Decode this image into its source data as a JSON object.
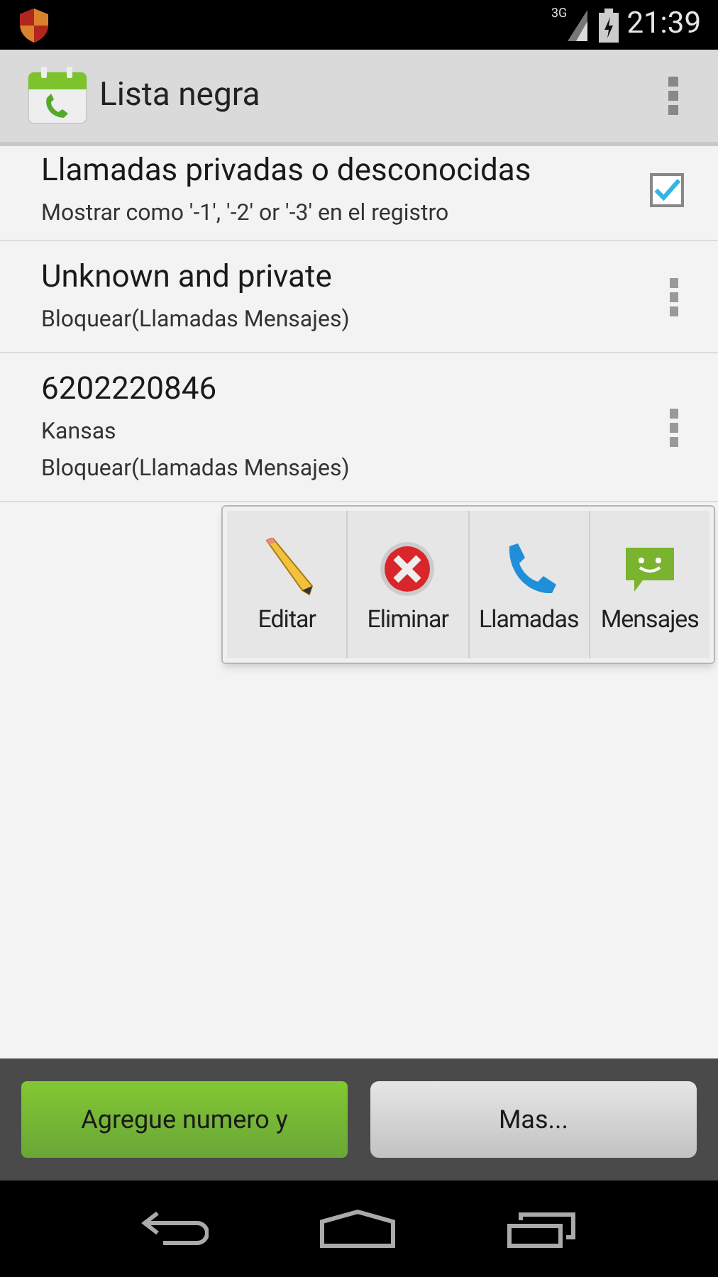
{
  "status_bar": {
    "time": "21:39",
    "network": "3G"
  },
  "action_bar": {
    "title": "Lista negra"
  },
  "rows": [
    {
      "kind": "checkbox",
      "title": "Llamadas privadas o desconocidas",
      "lines": [
        "Mostrar como '-1', '-2' or '-3' en el registro"
      ],
      "checked": true
    },
    {
      "kind": "menu",
      "title": "Unknown and private",
      "lines": [
        "Bloquear(Llamadas Mensajes)"
      ]
    },
    {
      "kind": "menu",
      "title": "6202220846",
      "lines": [
        "Kansas",
        "Bloquear(Llamadas Mensajes)"
      ]
    }
  ],
  "popup_menu": [
    {
      "kind": "edit",
      "label": "Editar"
    },
    {
      "kind": "delete",
      "label": "Eliminar"
    },
    {
      "kind": "call",
      "label": "Llamadas"
    },
    {
      "kind": "message",
      "label": "Mensajes"
    }
  ],
  "buttons": [
    {
      "kind": "primary",
      "label": "Agregue numero y"
    },
    {
      "kind": "secondary",
      "label": "Mas..."
    }
  ]
}
